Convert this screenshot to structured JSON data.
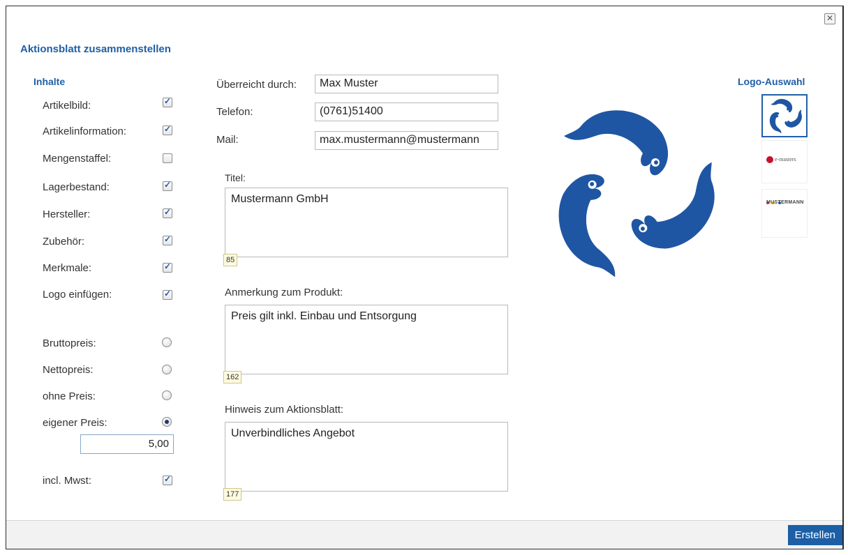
{
  "dialog": {
    "title": "Aktionsblatt zusammenstellen",
    "close_symbol": "✕",
    "submit_label": "Erstellen"
  },
  "inhalte": {
    "heading": "Inhalte",
    "options": [
      {
        "label": "Artikelbild:",
        "checked": true
      },
      {
        "label": "Artikelinformation:",
        "checked": true
      },
      {
        "label": "Mengenstaffel:",
        "checked": false
      },
      {
        "label": "Lagerbestand:",
        "checked": true
      },
      {
        "label": "Hersteller:",
        "checked": true
      },
      {
        "label": "Zubehör:",
        "checked": true
      },
      {
        "label": "Merkmale:",
        "checked": true
      },
      {
        "label": "Logo einfügen:",
        "checked": true
      }
    ]
  },
  "price": {
    "options": [
      {
        "label": "Bruttopreis:",
        "selected": false
      },
      {
        "label": "Nettopreis:",
        "selected": false
      },
      {
        "label": "ohne Preis:",
        "selected": false
      },
      {
        "label": "eigener Preis:",
        "selected": true
      }
    ],
    "custom_value": "5,00",
    "mwst_label": "incl. Mwst:",
    "mwst_checked": true
  },
  "contact": {
    "presented_by_label": "Überreicht durch:",
    "presented_by_value": "Max Muster",
    "phone_label": "Telefon:",
    "phone_value": "(0761)51400",
    "mail_label": "Mail:",
    "mail_value": "max.mustermann@mustermann"
  },
  "texts": {
    "title_label": "Titel:",
    "title_value": "Mustermann GmbH",
    "title_counter": "85",
    "note_label": "Anmerkung zum Produkt:",
    "note_value": "Preis gilt inkl. Einbau und Entsorgung",
    "note_counter": "162",
    "hint_label": "Hinweis zum Aktionsblatt:",
    "hint_value": "Unverbindliches Angebot",
    "hint_counter": "177"
  },
  "logo_selection": {
    "heading": "Logo-Auswahl",
    "logos": [
      {
        "name": "fish-logo",
        "text": "",
        "selected": true
      },
      {
        "name": "e-masters-logo",
        "text": "e-masters",
        "selected": false
      },
      {
        "name": "mustermann-logo",
        "text": "MUSTERMANN",
        "selected": false
      }
    ]
  },
  "colors": {
    "accent": "#1f5fa6",
    "fish": "#1f56a3",
    "emasters_red": "#c8102e"
  }
}
